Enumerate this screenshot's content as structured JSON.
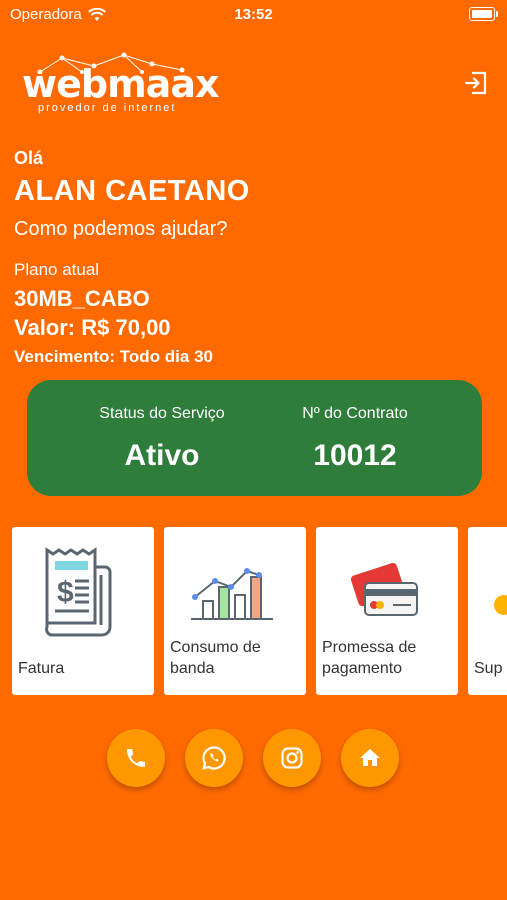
{
  "status_bar": {
    "carrier": "Operadora",
    "time": "13:52"
  },
  "brand": {
    "logo_text": "webmaax",
    "tagline": "provedor de internet"
  },
  "greeting": {
    "hello": "Olá",
    "name": "ALAN CAETANO",
    "prompt": "Como podemos ajudar?"
  },
  "plan": {
    "label": "Plano atual",
    "name": "30MB_CABO",
    "value": "Valor: R$ 70,00",
    "due": "Vencimento: Todo dia 30"
  },
  "service": {
    "status_label": "Status do Serviço",
    "status_value": "Ativo",
    "contract_label": "Nº do Contrato",
    "contract_value": "10012"
  },
  "tiles": [
    {
      "label": "Fatura",
      "icon": "invoice-icon"
    },
    {
      "label": "Consumo de banda",
      "icon": "bandwidth-chart-icon"
    },
    {
      "label": "Promessa de pagamento",
      "icon": "credit-card-icon"
    },
    {
      "label": "Sup",
      "icon": "support-icon"
    }
  ],
  "actions": [
    {
      "icon": "phone-icon"
    },
    {
      "icon": "whatsapp-icon"
    },
    {
      "icon": "instagram-icon"
    },
    {
      "icon": "home-icon"
    }
  ],
  "colors": {
    "background": "#FF6A00",
    "card": "#2E7D3A",
    "fab": "#FF9800"
  }
}
